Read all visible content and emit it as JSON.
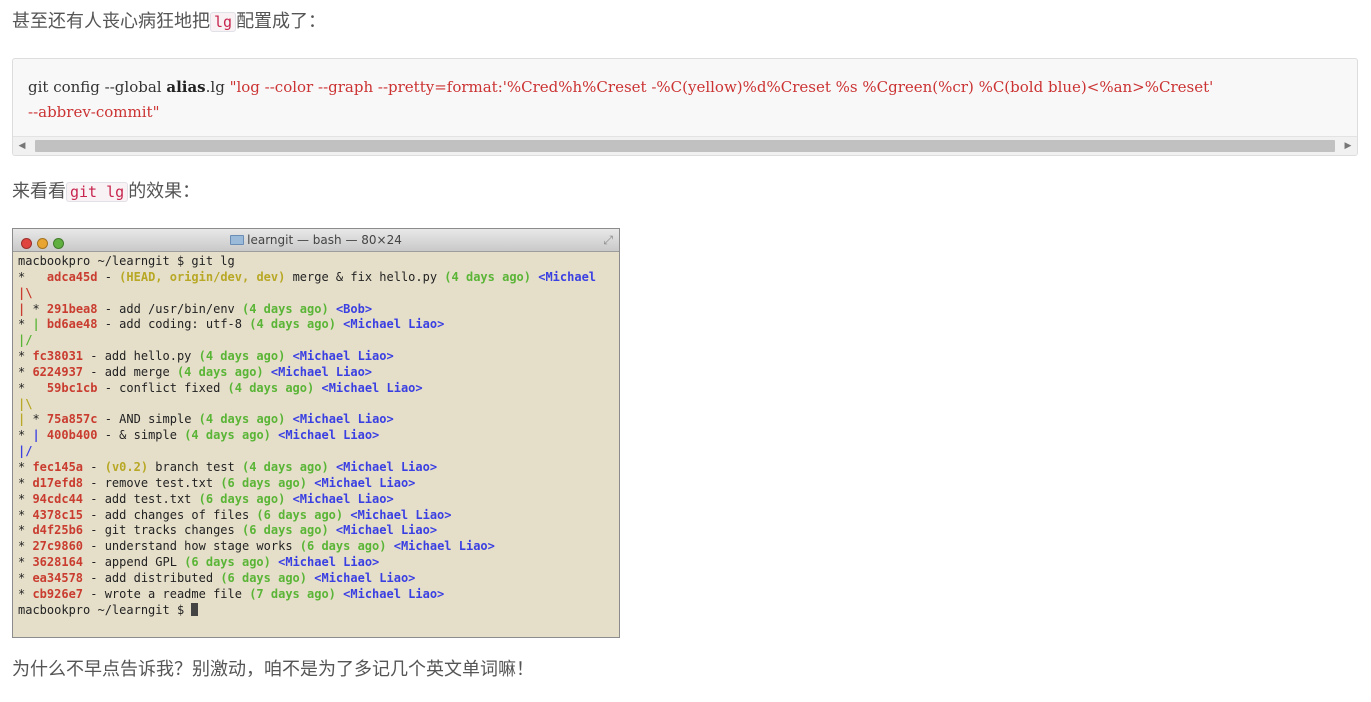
{
  "para1": {
    "before": "甚至还有人丧心病狂地把",
    "code": "lg",
    "after": "配置成了："
  },
  "codeblock": {
    "line1": {
      "cmd": "git config --global ",
      "kw": "alias",
      "rest": ".lg ",
      "str": "\"log --color --graph --pretty=format:'%Cred%h%Creset -%C(yellow)%d%Creset %s %Cgreen(%cr) %C(bold blue)<%an>%Creset'"
    },
    "line2": "--abbrev-commit\"",
    "scroll_left_icon": "arrow-left-icon",
    "scroll_right_icon": "arrow-right-icon"
  },
  "para2": {
    "before": "来看看",
    "code": "git lg",
    "after": "的效果："
  },
  "terminal": {
    "title": "learngit — bash — 80×24",
    "lines": [
      {
        "segs": [
          {
            "t": "macbookpro ~/learngit $ git lg",
            "c": ""
          }
        ]
      },
      {
        "segs": [
          {
            "t": "*   ",
            "c": ""
          },
          {
            "t": "adca45d",
            "c": "c-red"
          },
          {
            "t": " - ",
            "c": ""
          },
          {
            "t": "(HEAD, origin/dev, dev)",
            "c": "c-yellow"
          },
          {
            "t": " merge & fix hello.py ",
            "c": ""
          },
          {
            "t": "(4 days ago)",
            "c": "c-green"
          },
          {
            "t": " ",
            "c": ""
          },
          {
            "t": "<Michael",
            "c": "c-blue"
          }
        ]
      },
      {
        "segs": [
          {
            "t": "|\\",
            "c": "c-red"
          }
        ]
      },
      {
        "segs": [
          {
            "t": "|",
            "c": "c-red"
          },
          {
            "t": " * ",
            "c": ""
          },
          {
            "t": "291bea8",
            "c": "c-red"
          },
          {
            "t": " - add /usr/bin/env ",
            "c": ""
          },
          {
            "t": "(4 days ago)",
            "c": "c-green"
          },
          {
            "t": " ",
            "c": ""
          },
          {
            "t": "<Bob>",
            "c": "c-blue"
          }
        ]
      },
      {
        "segs": [
          {
            "t": "* ",
            "c": ""
          },
          {
            "t": "|",
            "c": "c-green"
          },
          {
            "t": " ",
            "c": ""
          },
          {
            "t": "bd6ae48",
            "c": "c-red"
          },
          {
            "t": " - add coding: utf-8 ",
            "c": ""
          },
          {
            "t": "(4 days ago)",
            "c": "c-green"
          },
          {
            "t": " ",
            "c": ""
          },
          {
            "t": "<Michael Liao>",
            "c": "c-blue"
          }
        ]
      },
      {
        "segs": [
          {
            "t": "|/",
            "c": "c-green"
          }
        ]
      },
      {
        "segs": [
          {
            "t": "* ",
            "c": ""
          },
          {
            "t": "fc38031",
            "c": "c-red"
          },
          {
            "t": " - add hello.py ",
            "c": ""
          },
          {
            "t": "(4 days ago)",
            "c": "c-green"
          },
          {
            "t": " ",
            "c": ""
          },
          {
            "t": "<Michael Liao>",
            "c": "c-blue"
          }
        ]
      },
      {
        "segs": [
          {
            "t": "* ",
            "c": ""
          },
          {
            "t": "6224937",
            "c": "c-red"
          },
          {
            "t": " - add merge ",
            "c": ""
          },
          {
            "t": "(4 days ago)",
            "c": "c-green"
          },
          {
            "t": " ",
            "c": ""
          },
          {
            "t": "<Michael Liao>",
            "c": "c-blue"
          }
        ]
      },
      {
        "segs": [
          {
            "t": "*   ",
            "c": ""
          },
          {
            "t": "59bc1cb",
            "c": "c-red"
          },
          {
            "t": " - conflict fixed ",
            "c": ""
          },
          {
            "t": "(4 days ago)",
            "c": "c-green"
          },
          {
            "t": " ",
            "c": ""
          },
          {
            "t": "<Michael Liao>",
            "c": "c-blue"
          }
        ]
      },
      {
        "segs": [
          {
            "t": "|\\",
            "c": "c-yellow"
          }
        ]
      },
      {
        "segs": [
          {
            "t": "|",
            "c": "c-yellow"
          },
          {
            "t": " * ",
            "c": ""
          },
          {
            "t": "75a857c",
            "c": "c-red"
          },
          {
            "t": " - AND simple ",
            "c": ""
          },
          {
            "t": "(4 days ago)",
            "c": "c-green"
          },
          {
            "t": " ",
            "c": ""
          },
          {
            "t": "<Michael Liao>",
            "c": "c-blue"
          }
        ]
      },
      {
        "segs": [
          {
            "t": "* ",
            "c": ""
          },
          {
            "t": "|",
            "c": "c-blue"
          },
          {
            "t": " ",
            "c": ""
          },
          {
            "t": "400b400",
            "c": "c-red"
          },
          {
            "t": " - & simple ",
            "c": ""
          },
          {
            "t": "(4 days ago)",
            "c": "c-green"
          },
          {
            "t": " ",
            "c": ""
          },
          {
            "t": "<Michael Liao>",
            "c": "c-blue"
          }
        ]
      },
      {
        "segs": [
          {
            "t": "|/",
            "c": "c-blue"
          }
        ]
      },
      {
        "segs": [
          {
            "t": "* ",
            "c": ""
          },
          {
            "t": "fec145a",
            "c": "c-red"
          },
          {
            "t": " - ",
            "c": ""
          },
          {
            "t": "(v0.2)",
            "c": "c-yellow"
          },
          {
            "t": " branch test ",
            "c": ""
          },
          {
            "t": "(4 days ago)",
            "c": "c-green"
          },
          {
            "t": " ",
            "c": ""
          },
          {
            "t": "<Michael Liao>",
            "c": "c-blue"
          }
        ]
      },
      {
        "segs": [
          {
            "t": "* ",
            "c": ""
          },
          {
            "t": "d17efd8",
            "c": "c-red"
          },
          {
            "t": " - remove test.txt ",
            "c": ""
          },
          {
            "t": "(6 days ago)",
            "c": "c-green"
          },
          {
            "t": " ",
            "c": ""
          },
          {
            "t": "<Michael Liao>",
            "c": "c-blue"
          }
        ]
      },
      {
        "segs": [
          {
            "t": "* ",
            "c": ""
          },
          {
            "t": "94cdc44",
            "c": "c-red"
          },
          {
            "t": " - add test.txt ",
            "c": ""
          },
          {
            "t": "(6 days ago)",
            "c": "c-green"
          },
          {
            "t": " ",
            "c": ""
          },
          {
            "t": "<Michael Liao>",
            "c": "c-blue"
          }
        ]
      },
      {
        "segs": [
          {
            "t": "* ",
            "c": ""
          },
          {
            "t": "4378c15",
            "c": "c-red"
          },
          {
            "t": " - add changes of files ",
            "c": ""
          },
          {
            "t": "(6 days ago)",
            "c": "c-green"
          },
          {
            "t": " ",
            "c": ""
          },
          {
            "t": "<Michael Liao>",
            "c": "c-blue"
          }
        ]
      },
      {
        "segs": [
          {
            "t": "* ",
            "c": ""
          },
          {
            "t": "d4f25b6",
            "c": "c-red"
          },
          {
            "t": " - git tracks changes ",
            "c": ""
          },
          {
            "t": "(6 days ago)",
            "c": "c-green"
          },
          {
            "t": " ",
            "c": ""
          },
          {
            "t": "<Michael Liao>",
            "c": "c-blue"
          }
        ]
      },
      {
        "segs": [
          {
            "t": "* ",
            "c": ""
          },
          {
            "t": "27c9860",
            "c": "c-red"
          },
          {
            "t": " - understand how stage works ",
            "c": ""
          },
          {
            "t": "(6 days ago)",
            "c": "c-green"
          },
          {
            "t": " ",
            "c": ""
          },
          {
            "t": "<Michael Liao>",
            "c": "c-blue"
          }
        ]
      },
      {
        "segs": [
          {
            "t": "* ",
            "c": ""
          },
          {
            "t": "3628164",
            "c": "c-red"
          },
          {
            "t": " - append GPL ",
            "c": ""
          },
          {
            "t": "(6 days ago)",
            "c": "c-green"
          },
          {
            "t": " ",
            "c": ""
          },
          {
            "t": "<Michael Liao>",
            "c": "c-blue"
          }
        ]
      },
      {
        "segs": [
          {
            "t": "* ",
            "c": ""
          },
          {
            "t": "ea34578",
            "c": "c-red"
          },
          {
            "t": " - add distributed ",
            "c": ""
          },
          {
            "t": "(6 days ago)",
            "c": "c-green"
          },
          {
            "t": " ",
            "c": ""
          },
          {
            "t": "<Michael Liao>",
            "c": "c-blue"
          }
        ]
      },
      {
        "segs": [
          {
            "t": "* ",
            "c": ""
          },
          {
            "t": "cb926e7",
            "c": "c-red"
          },
          {
            "t": " - wrote a readme file ",
            "c": ""
          },
          {
            "t": "(7 days ago)",
            "c": "c-green"
          },
          {
            "t": " ",
            "c": ""
          },
          {
            "t": "<Michael Liao>",
            "c": "c-blue"
          }
        ]
      },
      {
        "segs": [
          {
            "t": "macbookpro ~/learngit $ ",
            "c": ""
          }
        ],
        "cursor": true
      }
    ]
  },
  "para3": {
    "text": "为什么不早点告诉我？别激动，咱不是为了多记几个英文单词嘛！"
  },
  "colors": {
    "terminal_bg": "#e5dfca",
    "inline_code": "#c7254e",
    "code_string": "#c33"
  }
}
